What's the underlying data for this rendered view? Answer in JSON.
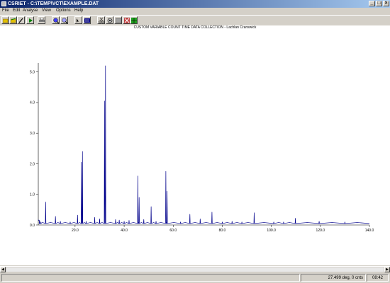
{
  "window": {
    "title": "CSRIET - C:\\TEMP\\VCT\\EXAMPLE.DAT"
  },
  "title_buttons": {
    "minimize": "_",
    "maximize": "□",
    "close": "×"
  },
  "menu": [
    "File",
    "Edit",
    "Analyse",
    "View",
    "Options",
    "Help"
  ],
  "toolbar": {
    "buttons": [
      "open-icon",
      "open-folder-icon",
      "edit-pen-icon",
      "play-icon",
      "print-icon",
      "zoom-in-icon",
      "zoom-out-icon",
      "cursor-select-icon",
      "data-list-icon",
      "cut-scissors-icon",
      "settings-icon",
      "image-icon",
      "close-red-icon"
    ]
  },
  "chart_data": {
    "type": "line",
    "title": "CUSTOM VARIABLE COUNT TIME DATA COLLECTION - Lachlan Cranswick",
    "xlabel": "",
    "ylabel": "",
    "xlim": [
      5,
      140
    ],
    "ylim": [
      0,
      5.2
    ],
    "x_ticks": [
      "20.0",
      "40.0",
      "60.0",
      "80.0",
      "100.0",
      "120.0",
      "140.0"
    ],
    "y_ticks": [
      "0.0",
      "1.0",
      "2.0",
      "3.0",
      "4.0",
      "5.0"
    ],
    "grid": false,
    "color": "#00008b",
    "baseline": 0.05,
    "peaks": [
      {
        "x": 5.5,
        "y": 0.15
      },
      {
        "x": 8.0,
        "y": 0.75
      },
      {
        "x": 12.0,
        "y": 0.28
      },
      {
        "x": 14.0,
        "y": 0.12
      },
      {
        "x": 18.0,
        "y": 0.1
      },
      {
        "x": 21.0,
        "y": 0.32
      },
      {
        "x": 22.6,
        "y": 2.05
      },
      {
        "x": 23.0,
        "y": 2.4
      },
      {
        "x": 24.5,
        "y": 0.12
      },
      {
        "x": 28.0,
        "y": 0.25
      },
      {
        "x": 30.0,
        "y": 0.2
      },
      {
        "x": 32.0,
        "y": 4.05
      },
      {
        "x": 32.4,
        "y": 5.2
      },
      {
        "x": 36.5,
        "y": 0.18
      },
      {
        "x": 38.0,
        "y": 0.16
      },
      {
        "x": 40.0,
        "y": 0.12
      },
      {
        "x": 42.0,
        "y": 0.15
      },
      {
        "x": 45.6,
        "y": 1.6
      },
      {
        "x": 46.1,
        "y": 0.9
      },
      {
        "x": 48.0,
        "y": 0.18
      },
      {
        "x": 51.0,
        "y": 0.6
      },
      {
        "x": 53.0,
        "y": 0.12
      },
      {
        "x": 57.0,
        "y": 1.75
      },
      {
        "x": 57.5,
        "y": 1.1
      },
      {
        "x": 63.0,
        "y": 0.1
      },
      {
        "x": 66.8,
        "y": 0.35
      },
      {
        "x": 71.0,
        "y": 0.2
      },
      {
        "x": 75.8,
        "y": 0.42
      },
      {
        "x": 80.0,
        "y": 0.1
      },
      {
        "x": 84.0,
        "y": 0.12
      },
      {
        "x": 88.0,
        "y": 0.1
      },
      {
        "x": 93.0,
        "y": 0.4
      },
      {
        "x": 101.0,
        "y": 0.1
      },
      {
        "x": 105.0,
        "y": 0.1
      },
      {
        "x": 109.8,
        "y": 0.22
      },
      {
        "x": 119.5,
        "y": 0.12
      },
      {
        "x": 130.0,
        "y": 0.1
      }
    ]
  },
  "scrollbar": {
    "left_arrow": "◀",
    "right_arrow": "▶"
  },
  "status": {
    "position": "27.499 deg, 0 cnts",
    "time": "08:42"
  }
}
